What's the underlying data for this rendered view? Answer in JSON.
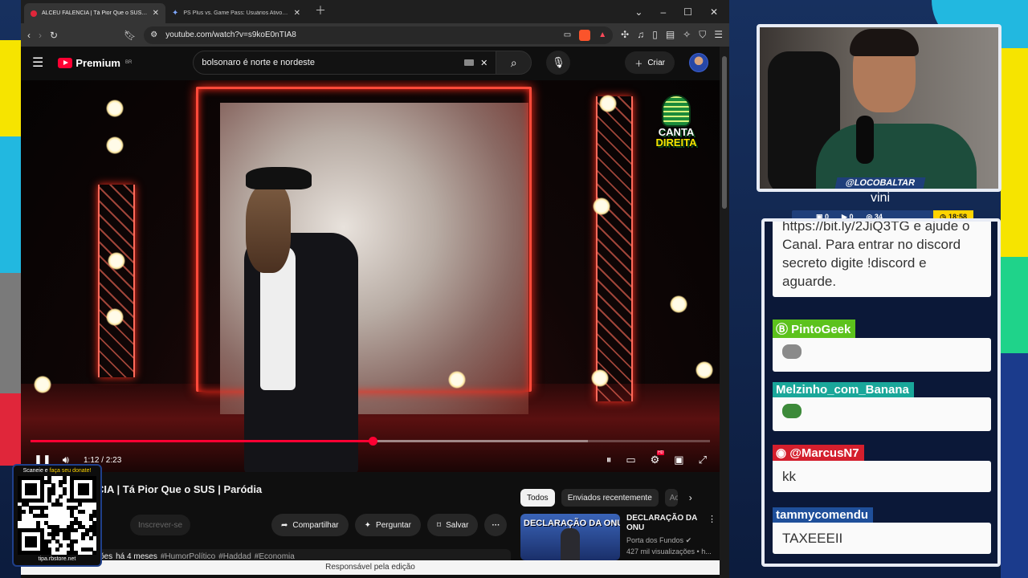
{
  "colors": {
    "stream_yellow": "#f6e400",
    "stream_cyan": "#22b8e0",
    "stream_red": "#e0263a",
    "stream_green": "#1fd38a",
    "yt_red": "#ff0033",
    "chat_green": "#5cc21c",
    "chat_teal": "#1aa79a",
    "chat_red": "#d41f2d",
    "chat_blue": "#1f4f9a"
  },
  "browser": {
    "tabs": [
      {
        "title": "ALCEU FALÊNCIA | Tá Pior Que o SUS | Paródia",
        "active": true,
        "icon": "record-icon"
      },
      {
        "title": "PS Plus vs. Game Pass: Usuários Ativos - Google Gemini",
        "active": false,
        "icon": "gemini-icon"
      }
    ],
    "url": "youtube.com/watch?v=s9koE0nTIA8"
  },
  "youtube": {
    "logo_text": "Premium",
    "logo_region": "BR",
    "search_query": "bolsonaro é norte e nordeste",
    "create_label": "Criar",
    "player": {
      "time_display": "1:12 / 2:23",
      "progress_fraction": 0.503,
      "buffered_fraction": 0.82,
      "channel_logo_line1": "CANTA",
      "channel_logo_line2": "DIREITA"
    },
    "video_title": "CIA | Tá Pior Que o SUS | Paródia",
    "subscribe_label": "Inscrever-se",
    "actions": {
      "share": "Compartilhar",
      "ask": "Perguntar",
      "save": "Salvar"
    },
    "description": {
      "prefix": "ões",
      "age": "há 4 meses",
      "tags": [
        "#HumorPolítico",
        "#Haddad",
        "#Economia"
      ]
    },
    "chips": [
      "Todos",
      "Enviados recentemente",
      "Ao"
    ],
    "recommended": {
      "thumb_text": "DECLARAÇÃO DA ONU",
      "title": "DECLARAÇÃO DA ONU",
      "channel": "Porta dos Fundos",
      "views": "427 mil visualizações • h..."
    },
    "status_bar": "Responsável pela edição"
  },
  "qr": {
    "top_text_a": "Scaneie e ",
    "top_text_b": "faça seu donate!",
    "bottom_text": "tipa.rbstore.net"
  },
  "stream": {
    "handle": "@LOCOBALTAR",
    "name": "vini",
    "stats": {
      "a": "0",
      "b": "0",
      "c": "34",
      "time": "18:58"
    }
  },
  "chat": [
    {
      "user": "",
      "text": "https://bit.ly/2JiQ3TG e ajude o Canal. Para entrar no discord secreto digite !discord e aguarde.",
      "color": ""
    },
    {
      "user": "PintoGeek",
      "text": "",
      "emote": "rat-emote-icon",
      "color": "#5cc21c"
    },
    {
      "user": "Melzinho_com_Banana",
      "text": "",
      "emote": "pepe-emote-icon",
      "color": "#1aa79a"
    },
    {
      "user": "@MarcusN7",
      "text": "kk",
      "color": "#d41f2d"
    },
    {
      "user": "tammycomendu",
      "text": "TAXEEEII",
      "color": "#1f4f9a"
    }
  ]
}
